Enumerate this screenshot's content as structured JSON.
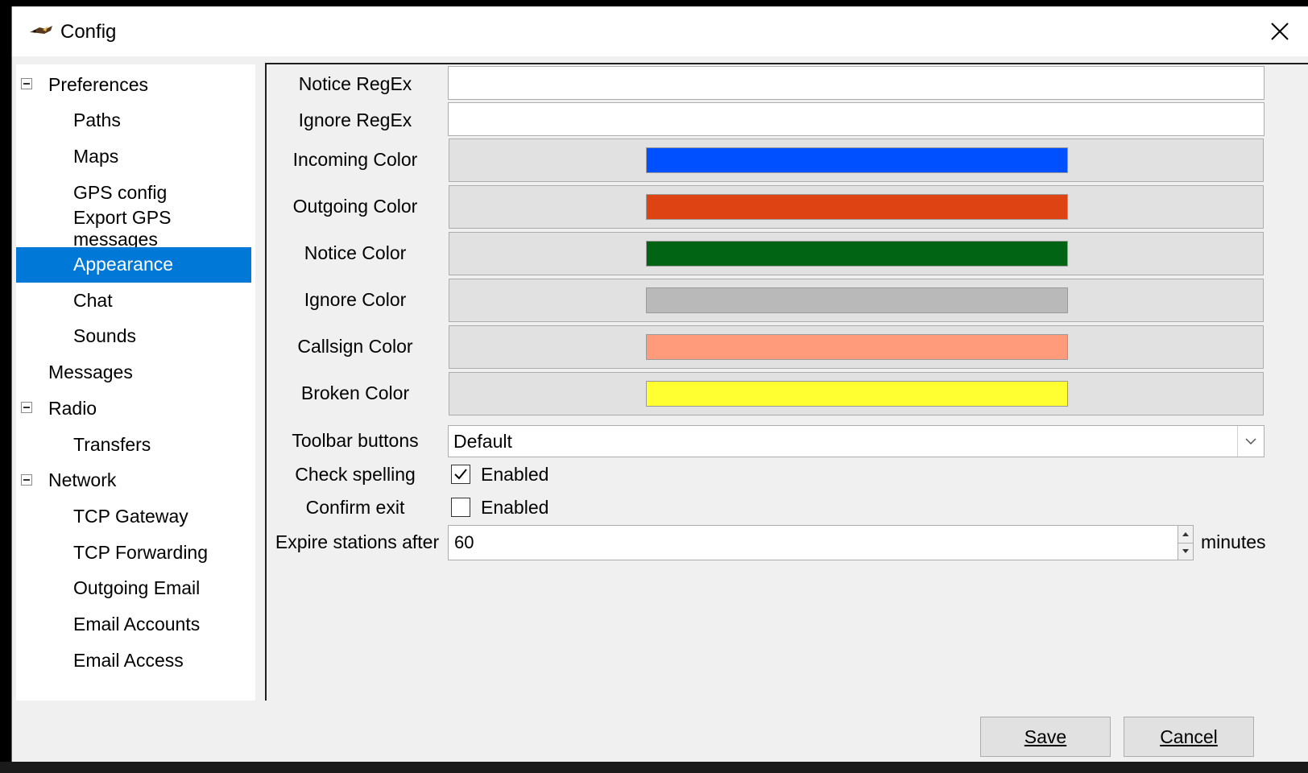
{
  "window": {
    "title": "Config",
    "icon": "app-bird-icon"
  },
  "tree": [
    {
      "label": "Preferences",
      "level": 0,
      "expandable": true
    },
    {
      "label": "Paths",
      "level": 1
    },
    {
      "label": "Maps",
      "level": 1
    },
    {
      "label": "GPS config",
      "level": 1
    },
    {
      "label": "Export GPS messages",
      "level": 1
    },
    {
      "label": "Appearance",
      "level": 1,
      "selected": true
    },
    {
      "label": "Chat",
      "level": 1
    },
    {
      "label": "Sounds",
      "level": 1
    },
    {
      "label": "Messages",
      "level": 0
    },
    {
      "label": "Radio",
      "level": 0,
      "expandable": true
    },
    {
      "label": "Transfers",
      "level": 1
    },
    {
      "label": "Network",
      "level": 0,
      "expandable": true
    },
    {
      "label": "TCP Gateway",
      "level": 1
    },
    {
      "label": "TCP Forwarding",
      "level": 1
    },
    {
      "label": "Outgoing Email",
      "level": 1
    },
    {
      "label": "Email Accounts",
      "level": 1
    },
    {
      "label": "Email Access",
      "level": 1
    }
  ],
  "form": {
    "notice_regex": {
      "label": "Notice RegEx",
      "value": ""
    },
    "ignore_regex": {
      "label": "Ignore RegEx",
      "value": ""
    },
    "colors": [
      {
        "label": "Incoming Color",
        "color": "#0050ff"
      },
      {
        "label": "Outgoing Color",
        "color": "#dd4313"
      },
      {
        "label": "Notice Color",
        "color": "#006414"
      },
      {
        "label": "Ignore Color",
        "color": "#b9b9b9"
      },
      {
        "label": "Callsign Color",
        "color": "#ff9b7a"
      },
      {
        "label": "Broken Color",
        "color": "#ffff31"
      }
    ],
    "toolbar_buttons": {
      "label": "Toolbar buttons",
      "value": "Default"
    },
    "check_spelling": {
      "label": "Check spelling",
      "option": "Enabled",
      "checked": true
    },
    "confirm_exit": {
      "label": "Confirm exit",
      "option": "Enabled",
      "checked": false
    },
    "expire_stations": {
      "label": "Expire stations after",
      "value": "60",
      "unit": "minutes"
    }
  },
  "buttons": {
    "save": "Save",
    "cancel": "Cancel"
  }
}
